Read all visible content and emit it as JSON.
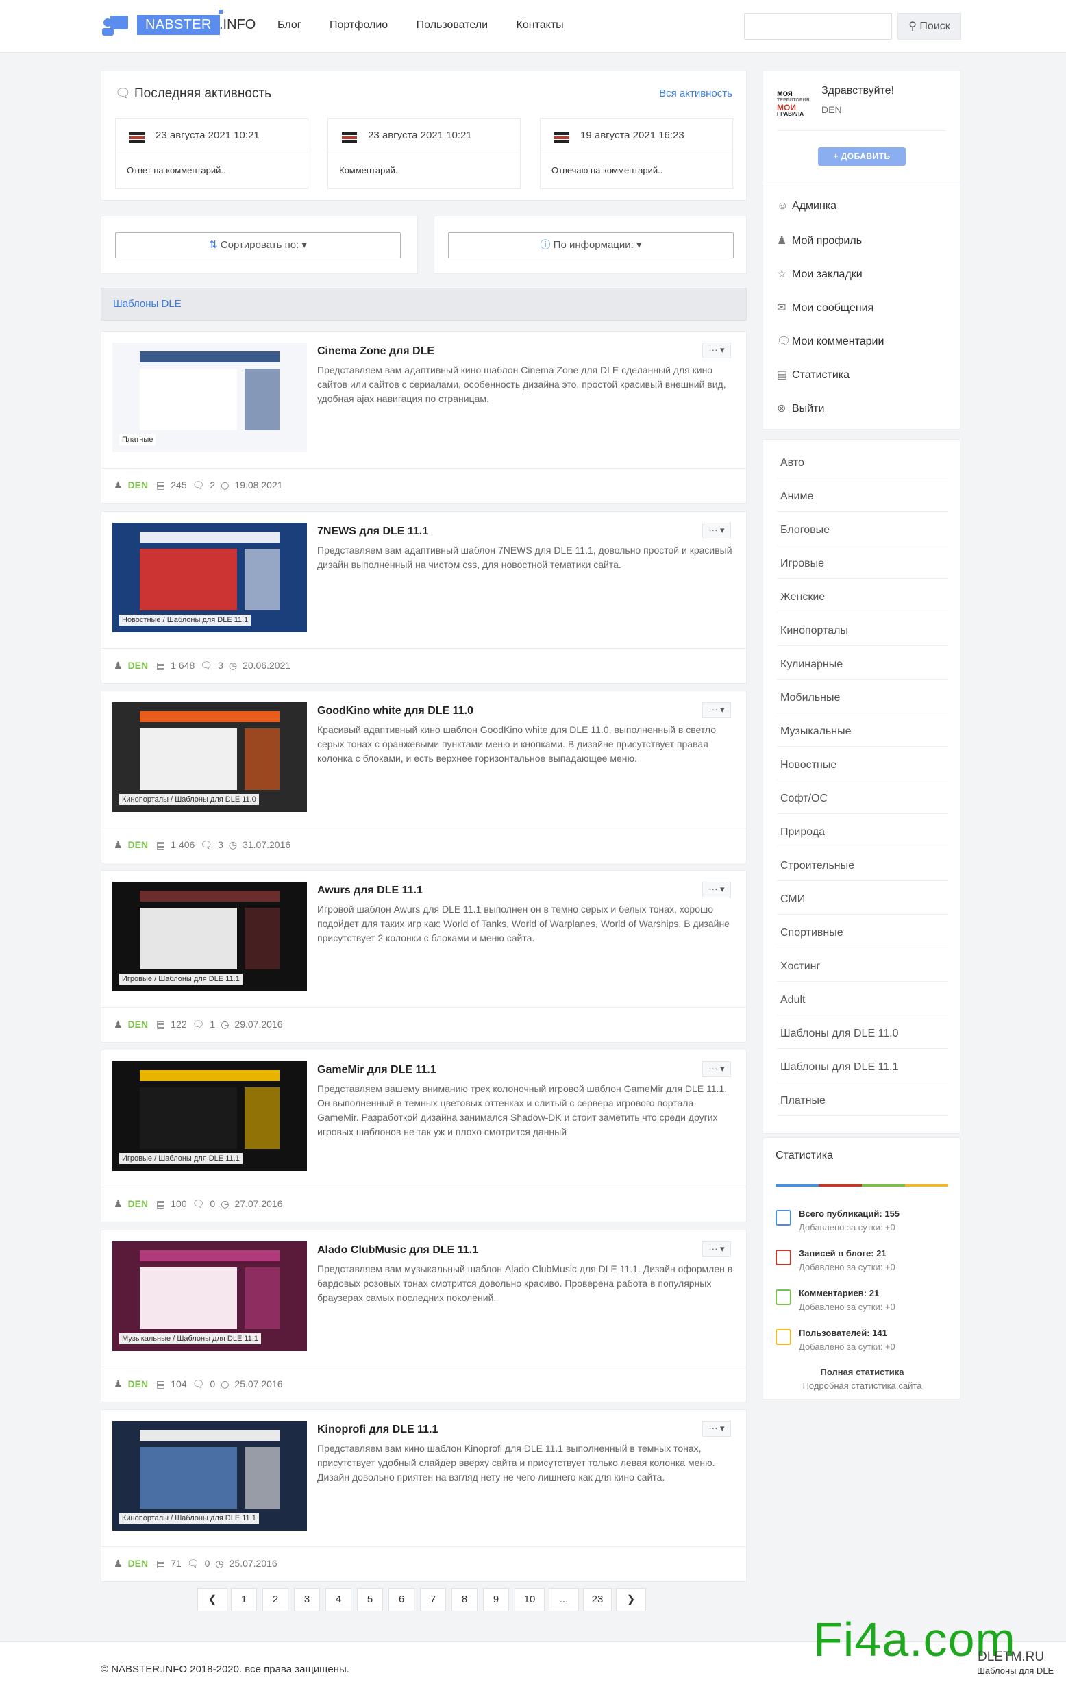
{
  "header": {
    "logo": "NABSTER",
    "logo_suffix": ".INFO",
    "nav": [
      "Блог",
      "Портфолио",
      "Пользователи",
      "Контакты"
    ],
    "search_label": "Поиск",
    "search_value": ""
  },
  "activity": {
    "title": "Последняя активность",
    "all_link": "Вся активность",
    "items": [
      {
        "date": "23 августа 2021 10:21",
        "text": "Ответ на комментарий.."
      },
      {
        "date": "23 августа 2021 10:21",
        "text": "Комментарий.."
      },
      {
        "date": "19 августа 2021 16:23",
        "text": "Отвечаю на комментарий.."
      }
    ]
  },
  "sort": {
    "sort_label": "Сортировать по:",
    "info_label": "По информации:"
  },
  "section": {
    "title": "Шаблоны DLE"
  },
  "posts": [
    {
      "title": "Cinema Zone для DLE",
      "desc": "Представляем вам адаптивный кино шаблон Cinema Zone для DLE сделанный для кино сайтов или сайтов с сериалами, особенность дизайна это, простой красивый внешний вид, удобная ajax навигация по страницам.",
      "cat": "Платные",
      "author": "DEN",
      "views": "245",
      "comments": "2",
      "date": "19.08.2021"
    },
    {
      "title": "7NEWS для DLE 11.1",
      "desc": "Представляем вам адаптивный шаблон 7NEWS для DLE 11.1, довольно простой и красивый дизайн выполненный на чистом css, для новостной тематики сайта.",
      "cat": "Новостные / Шаблоны для DLE 11.1",
      "author": "DEN",
      "views": "1 648",
      "comments": "3",
      "date": "20.06.2021"
    },
    {
      "title": "GoodKino white для DLE 11.0",
      "desc": "Красивый адаптивный кино шаблон GoodKino white для DLE 11.0, выполненный в светло серых тонах с оранжевыми пунктами меню и кнопками. В дизайне присутствует правая колонка с блоками, и есть верхнее горизонтальное выпадающее меню.",
      "cat": "Кинопорталы / Шаблоны для DLE 11.0",
      "author": "DEN",
      "views": "1 406",
      "comments": "3",
      "date": "31.07.2016"
    },
    {
      "title": "Awurs для DLE 11.1",
      "desc": "Игровой шаблон Awurs для DLE 11.1 выполнен он в темно серых и белых тонах, хорошо подойдет для таких игр как: World of Tanks, World of Warplanes, World of Warships. В дизайне присутствует 2 колонки с блоками и меню сайта.",
      "cat": "Игровые / Шаблоны для DLE 11.1",
      "author": "DEN",
      "views": "122",
      "comments": "1",
      "date": "29.07.2016"
    },
    {
      "title": "GameMir для DLE 11.1",
      "desc": "Представляем вашему вниманию трех колоночный игровой шаблон GameMir для DLE 11.1. Он выполненный в темных цветовых оттенках и слитый с сервера игрового портала GameMir. Разработкой дизайна занимался Shadow-DK и стоит заметить что среди других игровых шаблонов не так уж и плохо смотрится данный",
      "cat": "Игровые / Шаблоны для DLE 11.1",
      "author": "DEN",
      "views": "100",
      "comments": "0",
      "date": "27.07.2016"
    },
    {
      "title": "Alado ClubMusic для DLE 11.1",
      "desc": "Представляем вам музыкальный шаблон Alado ClubMusic для DLE 11.1. Дизайн оформлен в бардовых розовых тонах смотрится довольно красиво. Проверена работа в популярных браузерах самых последних поколений.",
      "cat": "Музыкальные / Шаблоны для DLE 11.1",
      "author": "DEN",
      "views": "104",
      "comments": "0",
      "date": "25.07.2016"
    },
    {
      "title": "Kinoprofi для DLE 11.1",
      "desc": "Представляем вам кино шаблон Kinoprofi для DLE 11.1 выполненный в темных тонах, присутствует удобный слайдер вверху сайта и присутствует только левая колонка меню. Дизайн довольно приятен на взгляд нету не чего лишнего как для кино сайта.",
      "cat": "Кинопорталы / Шаблоны для DLE 11.1",
      "author": "DEN",
      "views": "71",
      "comments": "0",
      "date": "25.07.2016"
    }
  ],
  "pagination": [
    "1",
    "2",
    "3",
    "4",
    "5",
    "6",
    "7",
    "8",
    "9",
    "10",
    "...",
    "23"
  ],
  "user": {
    "greeting": "Здравствуйте!",
    "name": "DEN",
    "add_button": "+ ДОБАВИТЬ",
    "avatar_text": [
      "моя",
      "МОИ",
      "ПРАВИЛА"
    ],
    "links": [
      "Админка",
      "Мой профиль",
      "Мои закладки",
      "Мои сообщения",
      "Мои комментарии",
      "Статистика",
      "Выйти"
    ]
  },
  "categories": [
    "Авто",
    "Аниме",
    "Блоговые",
    "Игровые",
    "Женские",
    "Кинопорталы",
    "Кулинарные",
    "Мобильные",
    "Музыкальные",
    "Новостные",
    "Софт/ОС",
    "Природа",
    "Строительные",
    "СМИ",
    "Спортивные",
    "Хостинг",
    "Adult",
    "Шаблоны для DLE 11.0",
    "Шаблоны для DLE 11.1",
    "Платные"
  ],
  "stats": {
    "title": "Статистика",
    "rows": [
      {
        "label": "Всего публикаций: 155",
        "sub": "Добавлено за сутки: +0",
        "color": "#4a90d9"
      },
      {
        "label": "Записей в блоге: 21",
        "sub": "Добавлено за сутки: +0",
        "color": "#c0392b"
      },
      {
        "label": "Комментариев: 21",
        "sub": "Добавлено за сутки: +0",
        "color": "#7bc04a"
      },
      {
        "label": "Пользователей: 141",
        "sub": "Добавлено за сутки: +0",
        "color": "#f1b82d"
      }
    ],
    "full": "Полная статистика",
    "full_sub": "Подробная статистика сайта"
  },
  "footer": {
    "copyright": "© NABSTER.INFO 2018-2020. все права защищены."
  },
  "watermark": {
    "main": "Fi4a.com",
    "site": "DLETM.RU",
    "sub": "Шаблоны для DLE"
  }
}
